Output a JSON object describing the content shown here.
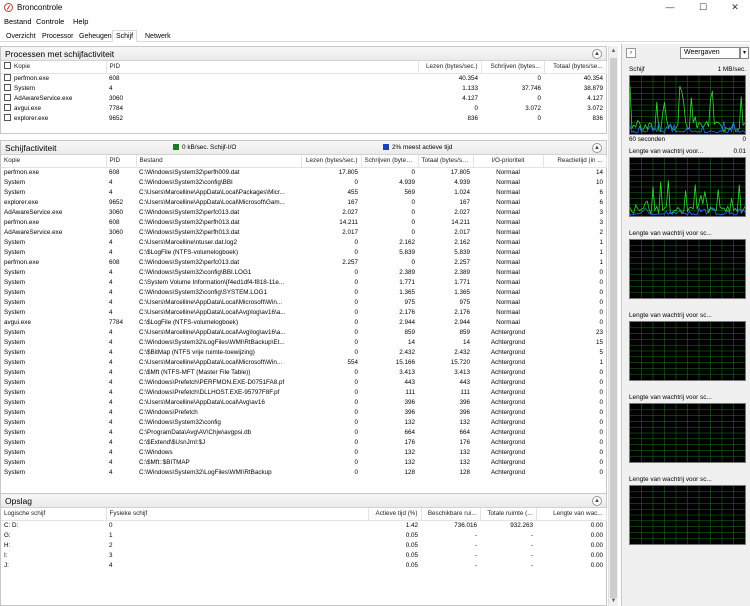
{
  "window": {
    "title": "Broncontrole",
    "minimize": "—",
    "maximize": "☐",
    "close": "✕"
  },
  "menu": [
    "Bestand",
    "Controle",
    "Help"
  ],
  "tabs": [
    "Overzicht",
    "Processor",
    "Geheugen",
    "Schijf",
    "Netwerk"
  ],
  "active_tab": "Schijf",
  "processes": {
    "title": "Processen met schijfactiviteit",
    "columns": [
      "Kopie",
      "PID",
      "Lezen (bytes/sec.)",
      "Schrijven (bytes...",
      "Totaal (bytes/se..."
    ],
    "rows": [
      [
        "perfmon.exe",
        "608",
        "40.354",
        "0",
        "40.354"
      ],
      [
        "System",
        "4",
        "1.133",
        "37.746",
        "38.879"
      ],
      [
        "AdAwareService.exe",
        "3060",
        "4.127",
        "0",
        "4.127"
      ],
      [
        "avgui.exe",
        "7784",
        "0",
        "3.072",
        "3.072"
      ],
      [
        "explorer.exe",
        "9652",
        "836",
        "0",
        "836"
      ]
    ]
  },
  "disk_activity": {
    "title": "Schijfactiviteit",
    "io_label": "0 kB/sec. Schijf-I/O",
    "active_label": "2% meest actieve tijd",
    "io_color": "#1e7a1e",
    "active_color": "#1f3fbf",
    "columns": [
      "Kopie",
      "PID",
      "Bestand",
      "Lezen (bytes/sec.)",
      "Schrijven (bytes...",
      "Totaal (bytes/se...",
      "I/O-prioriteit",
      "Reactietijd (in ..."
    ],
    "rows": [
      [
        "perfmon.exe",
        "608",
        "C:\\Windows\\System32\\perfh009.dat",
        "17.805",
        "0",
        "17.805",
        "Normaal",
        "14"
      ],
      [
        "System",
        "4",
        "C:\\Windows\\System32\\config\\BBI",
        "0",
        "4.939",
        "4.939",
        "Normaal",
        "10"
      ],
      [
        "System",
        "4",
        "C:\\Users\\Marcelline\\AppData\\Local\\Packages\\Micr...",
        "455",
        "569",
        "1.024",
        "Normaal",
        "6"
      ],
      [
        "explorer.exe",
        "9652",
        "C:\\Users\\Marcelline\\AppData\\Local\\Microsoft\\Gam...",
        "167",
        "0",
        "167",
        "Normaal",
        "6"
      ],
      [
        "AdAwareService.exe",
        "3060",
        "C:\\Windows\\System32\\perfc013.dat",
        "2.027",
        "0",
        "2.027",
        "Normaal",
        "3"
      ],
      [
        "perfmon.exe",
        "608",
        "C:\\Windows\\System32\\perfh013.dat",
        "14.211",
        "0",
        "14.211",
        "Normaal",
        "3"
      ],
      [
        "AdAwareService.exe",
        "3060",
        "C:\\Windows\\System32\\perfh013.dat",
        "2.017",
        "0",
        "2.017",
        "Normaal",
        "2"
      ],
      [
        "System",
        "4",
        "C:\\Users\\Marcelline\\ntuser.dat.log2",
        "0",
        "2.162",
        "2.162",
        "Normaal",
        "1"
      ],
      [
        "System",
        "4",
        "C:\\$LogFile (NTFS-volumelogboek)",
        "0",
        "5.839",
        "5.839",
        "Normaal",
        "1"
      ],
      [
        "perfmon.exe",
        "608",
        "C:\\Windows\\System32\\perfc013.dat",
        "2.257",
        "0",
        "2.257",
        "Normaal",
        "1"
      ],
      [
        "System",
        "4",
        "C:\\Windows\\System32\\config\\BBI.LOG1",
        "0",
        "2.389",
        "2.389",
        "Normaal",
        "0"
      ],
      [
        "System",
        "4",
        "C:\\System Volume Information\\{f4ed1df4-f818-11e...",
        "0",
        "1.771",
        "1.771",
        "Normaal",
        "0"
      ],
      [
        "System",
        "4",
        "C:\\Windows\\System32\\config\\SYSTEM.LOG1",
        "0",
        "1.365",
        "1.365",
        "Normaal",
        "0"
      ],
      [
        "System",
        "4",
        "C:\\Users\\Marcelline\\AppData\\Local\\Microsoft\\Win...",
        "0",
        "975",
        "975",
        "Normaal",
        "0"
      ],
      [
        "System",
        "4",
        "C:\\Users\\Marcelline\\AppData\\Local\\Avg\\log\\av16\\a...",
        "0",
        "2.176",
        "2.176",
        "Normaal",
        "0"
      ],
      [
        "avgui.exe",
        "7784",
        "C:\\$LogFile (NTFS-volumelogboek)",
        "0",
        "2.944",
        "2.944",
        "Normaal",
        "0"
      ],
      [
        "System",
        "4",
        "C:\\Users\\Marcelline\\AppData\\Local\\Avg\\log\\av16\\a...",
        "0",
        "859",
        "859",
        "Achtergrond",
        "23"
      ],
      [
        "System",
        "4",
        "C:\\Windows\\System32\\LogFiles\\WMI\\RtBackup\\Et...",
        "0",
        "14",
        "14",
        "Achtergrond",
        "15"
      ],
      [
        "System",
        "4",
        "C:\\$BitMap (NTFS vrije ruimte-toewijzing)",
        "0",
        "2.432",
        "2.432",
        "Achtergrond",
        "5"
      ],
      [
        "System",
        "4",
        "C:\\Users\\Marcelline\\AppData\\Local\\Microsoft\\Win...",
        "554",
        "15.166",
        "15.720",
        "Achtergrond",
        "1"
      ],
      [
        "System",
        "4",
        "C:\\$Mft (NTFS-MFT (Master File Table))",
        "0",
        "3.413",
        "3.413",
        "Achtergrond",
        "0"
      ],
      [
        "System",
        "4",
        "C:\\Windows\\Prefetch\\PERFMON.EXE-D0751FA8.pf",
        "0",
        "443",
        "443",
        "Achtergrond",
        "0"
      ],
      [
        "System",
        "4",
        "C:\\Windows\\Prefetch\\DLLHOST.EXE-95797F8F.pf",
        "0",
        "111",
        "111",
        "Achtergrond",
        "0"
      ],
      [
        "System",
        "4",
        "C:\\Users\\Marcelline\\AppData\\Local\\Avg\\av16",
        "0",
        "396",
        "396",
        "Achtergrond",
        "0"
      ],
      [
        "System",
        "4",
        "C:\\Windows\\Prefetch",
        "0",
        "396",
        "396",
        "Achtergrond",
        "0"
      ],
      [
        "System",
        "4",
        "C:\\Windows\\System32\\config",
        "0",
        "132",
        "132",
        "Achtergrond",
        "0"
      ],
      [
        "System",
        "4",
        "C:\\ProgramData\\Avg\\AV\\Chjw\\avgpsi.db",
        "0",
        "664",
        "664",
        "Achtergrond",
        "0"
      ],
      [
        "System",
        "4",
        "C:\\$Extend\\$UsnJrnl:$J",
        "0",
        "176",
        "176",
        "Achtergrond",
        "0"
      ],
      [
        "System",
        "4",
        "C:\\Windows",
        "0",
        "132",
        "132",
        "Achtergrond",
        "0"
      ],
      [
        "System",
        "4",
        "C:\\$Mft::$BITMAP",
        "0",
        "132",
        "132",
        "Achtergrond",
        "0"
      ],
      [
        "System",
        "4",
        "C:\\Windows\\System32\\LogFiles\\WMI\\RtBackup",
        "0",
        "128",
        "128",
        "Achtergrond",
        "0"
      ]
    ]
  },
  "storage": {
    "title": "Opslag",
    "columns": [
      "Logische schijf",
      "Fysieke schijf",
      "Actieve tijd (%)",
      "Beschikbare rui...",
      "Totale ruimte (...",
      "Lengte van wac..."
    ],
    "rows": [
      [
        "C: D:",
        "0",
        "1.42",
        "736.016",
        "932.263",
        "0.00"
      ],
      [
        "G:",
        "1",
        "0.05",
        "-",
        "-",
        "0.00"
      ],
      [
        "H:",
        "2",
        "0.05",
        "-",
        "-",
        "0.00"
      ],
      [
        "I:",
        "3",
        "0.05",
        "-",
        "-",
        "0.00"
      ],
      [
        "J:",
        "4",
        "0.05",
        "-",
        "-",
        "0.00"
      ]
    ]
  },
  "right_panel": {
    "expand": "›",
    "view_button": "Weergaven",
    "view_dropdown": "▾",
    "graphs": [
      {
        "label": "Schijf",
        "value": "1 MB/sec.",
        "foot_left": "60 seconden",
        "foot_right": "0",
        "kind": "activity"
      },
      {
        "label": "Lengte van wachtrij voor...",
        "value": "0.01",
        "foot_left": "",
        "foot_right": "",
        "kind": "queue"
      },
      {
        "label": "Lengte van wachtrij voor sc...",
        "value": "",
        "foot_left": "",
        "foot_right": "",
        "kind": "empty"
      },
      {
        "label": "Lengte van wachtrij voor sc...",
        "value": "",
        "foot_left": "",
        "foot_right": "",
        "kind": "empty"
      },
      {
        "label": "Lengte van wachtrij voor sc...",
        "value": "",
        "foot_left": "",
        "foot_right": "",
        "kind": "empty"
      },
      {
        "label": "Lengte van wachtrij voor sc...",
        "value": "",
        "foot_left": "",
        "foot_right": "",
        "kind": "empty"
      }
    ],
    "grid_color": "#1b7a1b",
    "line_green": "#33dd33",
    "line_blue": "#2a6fff"
  }
}
